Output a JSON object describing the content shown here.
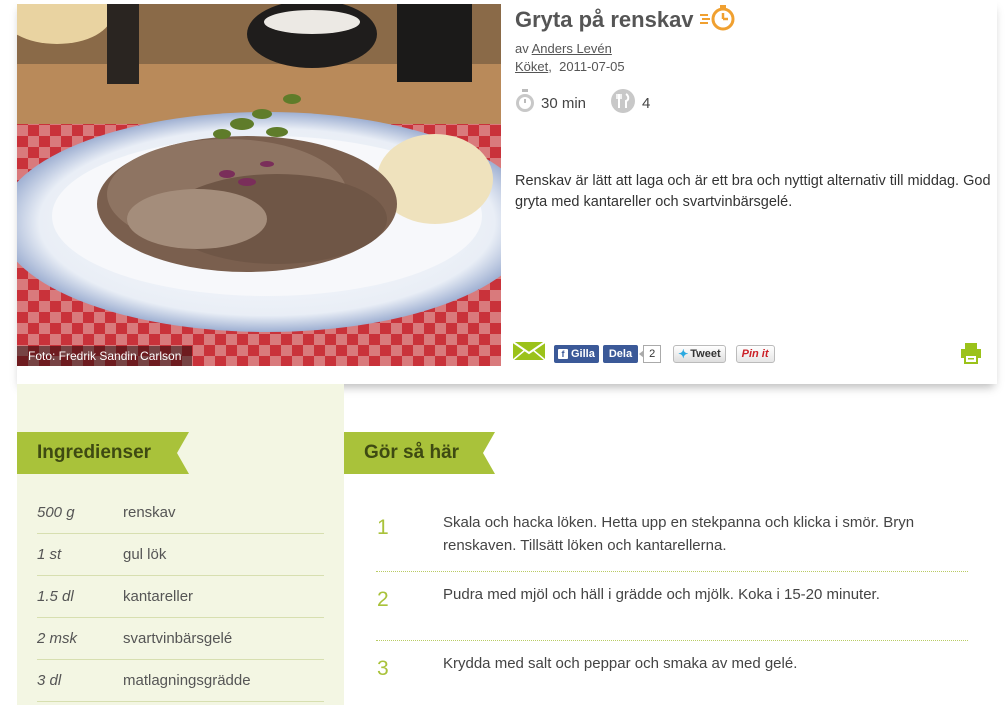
{
  "recipe": {
    "title": "Gryta på renskav",
    "author_prefix": "av",
    "author": "Anders Levén",
    "category": "Köket",
    "date": "2011-07-05",
    "time": "30 min",
    "servings": "4",
    "description": "Renskav är lätt att laga och är ett bra och nyttigt alternativ till middag. God gryta med kantareller och svartvinbärsgelé.",
    "photo_caption": "Foto: Fredrik Sandin Carlson"
  },
  "share": {
    "gilla_label": "Gilla",
    "dela_label": "Dela",
    "share_count": "2",
    "tweet_label": "Tweet",
    "pin_label": "Pin it"
  },
  "ingredients": {
    "heading": "Ingredienser",
    "items": [
      {
        "qty": "500 g",
        "name": "renskav"
      },
      {
        "qty": "1 st",
        "name": "gul lök"
      },
      {
        "qty": "1.5 dl",
        "name": "kantareller"
      },
      {
        "qty": "2 msk",
        "name": "svartvinbärsgelé"
      },
      {
        "qty": "3 dl",
        "name": "matlagningsgrädde"
      }
    ]
  },
  "instructions": {
    "heading": "Gör så här",
    "steps": [
      {
        "num": "1",
        "text": "Skala och hacka löken. Hetta upp en stekpanna och klicka i smör. Bryn renskaven. Tillsätt löken och kantarellerna."
      },
      {
        "num": "2",
        "text": "Pudra med mjöl och häll i grädde och mjölk. Koka i 15-20 minuter."
      },
      {
        "num": "3",
        "text": "Krydda med salt och peppar och smaka av med gelé."
      }
    ]
  },
  "colors": {
    "accent_green": "#a9c23a",
    "panel_bg": "#f3f6e3",
    "timer_orange": "#f0a030"
  },
  "icons": [
    "speed-timer-icon",
    "stopwatch-icon",
    "cutlery-icon",
    "mail-icon",
    "facebook-icon",
    "twitter-bird-icon",
    "print-icon"
  ]
}
